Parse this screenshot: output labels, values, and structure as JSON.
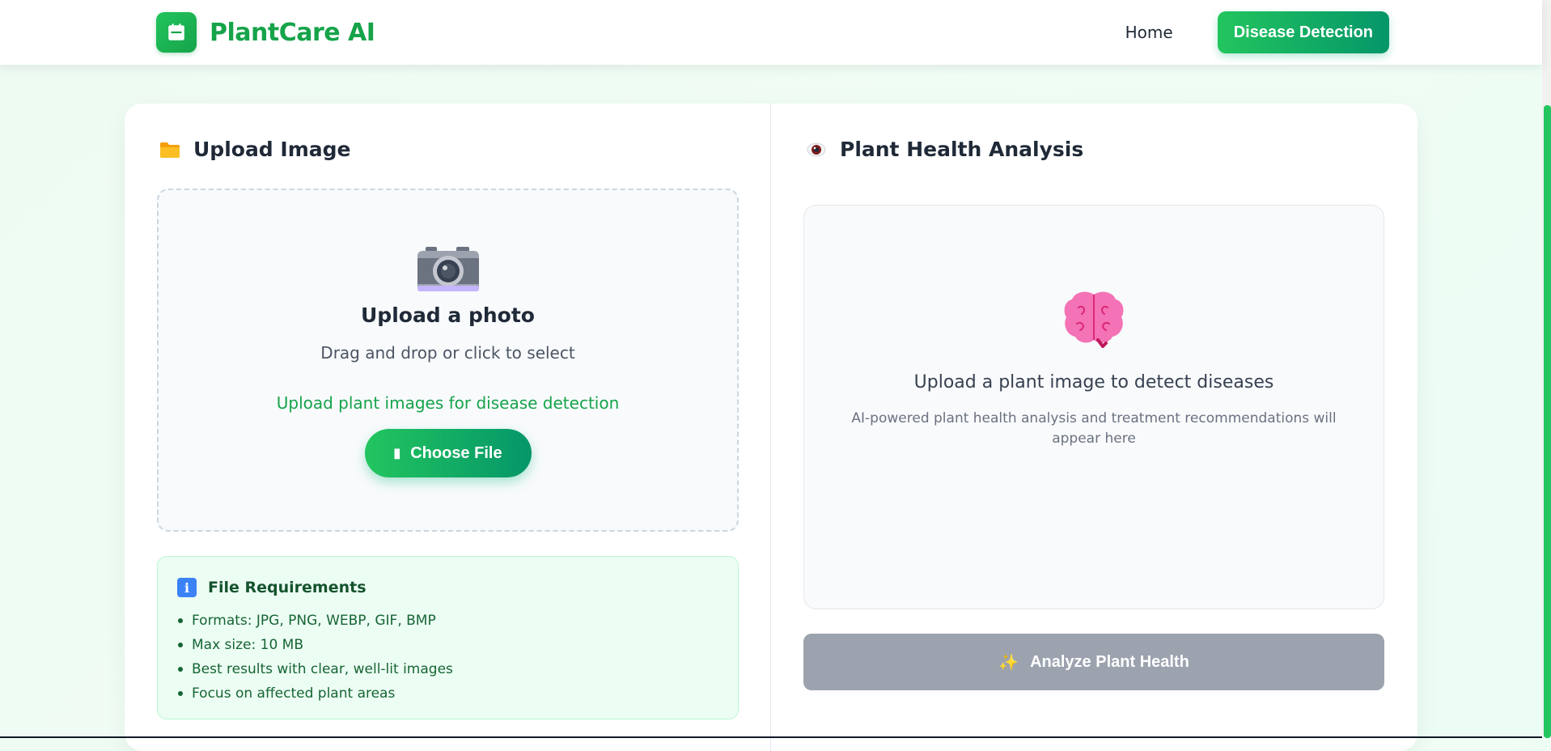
{
  "header": {
    "brand_name": "PlantCare AI",
    "nav_home": "Home",
    "nav_detect": "Disease Detection"
  },
  "upload": {
    "section_title": "Upload Image",
    "section_icon": "folder-icon",
    "dropzone_title": "Upload a photo",
    "dropzone_subtitle": "Drag and drop or click to select",
    "dropzone_hint": "Upload plant images for disease detection",
    "choose_button": "Choose File",
    "requirements": {
      "title": "File Requirements",
      "items": [
        "Formats: JPG, PNG, WEBP, GIF, BMP",
        "Max size: 10 MB",
        "Best results with clear, well-lit images",
        "Focus on affected plant areas"
      ]
    }
  },
  "analysis": {
    "section_title": "Plant Health Analysis",
    "section_icon": "eye-icon",
    "placeholder_title": "Upload a plant image to detect diseases",
    "placeholder_subtitle": "AI-powered plant health analysis and treatment recommendations will appear here",
    "analyze_button": "Analyze Plant Health",
    "analyze_disabled": true
  },
  "colors": {
    "brand": "#16a34a",
    "accent_gradient_start": "#22c55e",
    "accent_gradient_end": "#059669",
    "disabled_button": "#9ca3af"
  }
}
